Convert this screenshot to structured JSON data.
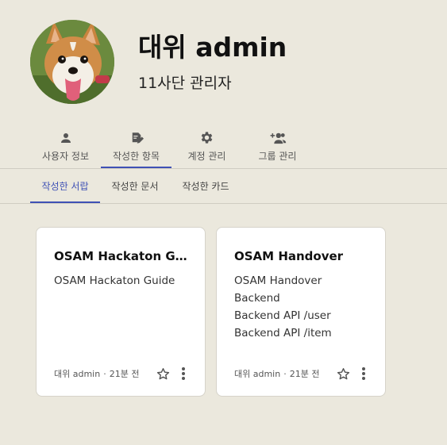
{
  "profile": {
    "name": "대위 admin",
    "role": "11사단 관리자"
  },
  "main_tabs": [
    {
      "label": "사용자 정보",
      "icon": "person-icon",
      "active": false
    },
    {
      "label": "작성한 항목",
      "icon": "edit-note-icon",
      "active": true
    },
    {
      "label": "계정 관리",
      "icon": "gear-icon",
      "active": false
    },
    {
      "label": "그룹 관리",
      "icon": "group-add-icon",
      "active": false
    }
  ],
  "sub_tabs": [
    {
      "label": "작성한 서랍",
      "active": true
    },
    {
      "label": "작성한 문서",
      "active": false
    },
    {
      "label": "작성한 카드",
      "active": false
    }
  ],
  "cards": [
    {
      "title": "OSAM Hackaton Guide",
      "lines": [
        "OSAM Hackaton Guide"
      ],
      "author": "대위 admin",
      "time": "21분 전"
    },
    {
      "title": "OSAM Handover",
      "lines": [
        "OSAM Handover",
        "Backend",
        "Backend API /user",
        "Backend API /item"
      ],
      "author": "대위 admin",
      "time": "21분 전"
    }
  ],
  "colors": {
    "background": "#ebe8dd",
    "accent": "#3f51b5",
    "card": "#ffffff"
  }
}
